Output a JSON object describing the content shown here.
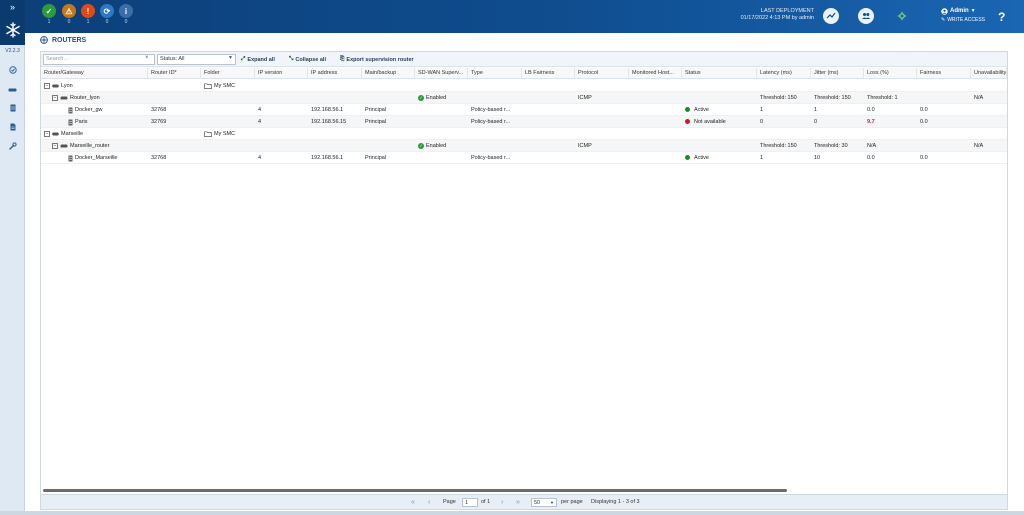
{
  "rail": {
    "expand": "»",
    "version": "V2.2.3"
  },
  "status_counts": [
    {
      "icon": "check-circle-icon",
      "color": "#2e9b3a",
      "count": "1"
    },
    {
      "icon": "warning-icon",
      "color": "#c4781a",
      "count": "0"
    },
    {
      "icon": "error-icon",
      "color": "#e04a14",
      "count": "1"
    },
    {
      "icon": "sync-icon",
      "color": "#2e78c8",
      "count": "0"
    },
    {
      "icon": "info-icon",
      "color": "#3a6ea5",
      "count": "0"
    }
  ],
  "header": {
    "last_deployment_label": "LAST DEPLOYMENT",
    "last_deployment_value": "01/17/2022 4:13 PM by admin",
    "user": "Admin",
    "access": "WRITE ACCESS",
    "help": "?"
  },
  "page": {
    "title": "ROUTERS"
  },
  "toolbar": {
    "search_placeholder": "Search...",
    "status_filter": "Status: All",
    "expand_all": "Expand all",
    "collapse_all": "Collapse all",
    "export": "Export supervision router"
  },
  "columns": [
    "Router/Gateway",
    "Router ID*",
    "Folder",
    "IP version",
    "IP address",
    "Main/backup",
    "SD-WAN Superv...",
    "Type",
    "LB Fairness",
    "Protocol",
    "Monitored Host...",
    "Status",
    "Latency (ms)",
    "Jitter (ms)",
    "Loss (%)",
    "Fairness",
    "Unavailability"
  ],
  "rows": [
    {
      "kind": "group",
      "level": 0,
      "name": "Lyon",
      "folder": "My SMC"
    },
    {
      "kind": "router",
      "level": 1,
      "name": "Router_lyon",
      "supervision": "Enabled",
      "protocol": "ICMP",
      "latency": "Threshold: 150",
      "jitter": "Threshold: 150",
      "loss": "Threshold: 1",
      "unavail": "N/A"
    },
    {
      "kind": "gateway",
      "level": 2,
      "name": "Docker_gw",
      "router_id": "32768",
      "ip_version": "4",
      "ip": "192.168.56.1",
      "main_backup": "Principal",
      "type": "Policy-based r...",
      "status": "Active",
      "status_color": "#1f8a2a",
      "latency": "1",
      "jitter": "1",
      "loss": "0.0",
      "fairness": "0.0"
    },
    {
      "kind": "gateway",
      "level": 2,
      "name": "Paris",
      "router_id": "32769",
      "ip_version": "4",
      "ip": "192.168.56.15",
      "main_backup": "Principal",
      "type": "Policy-based r...",
      "status": "Not available",
      "status_color": "#d11a1a",
      "latency": "0",
      "jitter": "0",
      "loss": "9.7",
      "loss_alert": true,
      "fairness": "0.0"
    },
    {
      "kind": "group",
      "level": 0,
      "name": "Marseille",
      "folder": "My SMC"
    },
    {
      "kind": "router",
      "level": 1,
      "name": "Marseille_router",
      "supervision": "Enabled",
      "protocol": "ICMP",
      "latency": "Threshold: 150",
      "jitter": "Threshold: 30",
      "loss": "N/A",
      "unavail": "N/A"
    },
    {
      "kind": "gateway",
      "level": 2,
      "name": "Docker_Marseille",
      "router_id": "32768",
      "ip_version": "4",
      "ip": "192.168.56.1",
      "main_backup": "Principal",
      "type": "Policy-based r...",
      "status": "Active",
      "status_color": "#1f8a2a",
      "latency": "1",
      "jitter": "10",
      "loss": "0.0",
      "fairness": "0.0"
    }
  ],
  "pager": {
    "first": "«",
    "prev": "‹",
    "page_label": "Page",
    "page_value": "1",
    "of_label": "of 1",
    "next": "›",
    "last": "»",
    "per_page_value": "50",
    "per_page_label": "per page",
    "displaying": "Displaying 1 - 3 of 3"
  }
}
